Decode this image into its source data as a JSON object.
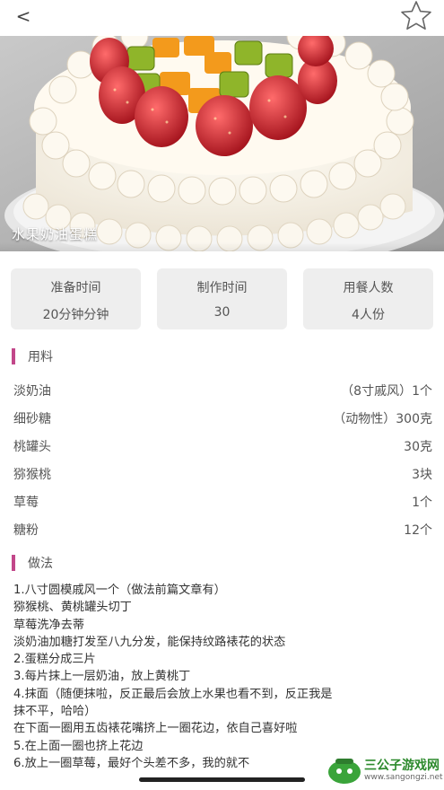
{
  "nav": {
    "back_glyph": "<",
    "back_icon": "chevron-left-icon",
    "favorite_icon": "star-outline-icon"
  },
  "hero": {
    "title": "水果奶油蛋糕"
  },
  "info_cards": [
    {
      "label": "准备时间",
      "value": "20分钟分钟"
    },
    {
      "label": "制作时间",
      "value": "30"
    },
    {
      "label": "用餐人数",
      "value": "4人份"
    }
  ],
  "ingredients": {
    "title": "用料",
    "items": [
      {
        "name": "淡奶油",
        "amount": "（8寸戚风）1个"
      },
      {
        "name": "细砂糖",
        "amount": "（动物性）300克"
      },
      {
        "name": "桃罐头",
        "amount": "30克"
      },
      {
        "name": "猕猴桃",
        "amount": "3块"
      },
      {
        "name": "草莓",
        "amount": "1个"
      },
      {
        "name": "糖粉",
        "amount": "12个"
      }
    ]
  },
  "method": {
    "title": "做法",
    "lines": [
      "1.八寸圆模戚风一个（做法前篇文章有）",
      "猕猴桃、黄桃罐头切丁",
      "草莓洗净去蒂",
      "淡奶油加糖打发至八九分发，能保持纹路裱花的状态",
      "2.蛋糕分成三片",
      "3.每片抹上一层奶油，放上黄桃丁",
      "4.抹面（随便抹啦，反正最后会放上水果也看不到，反正我是",
      "抹不平，哈哈）",
      "在下面一圈用五齿裱花嘴挤上一圈花边，依自己喜好啦",
      "5.在上面一圈也挤上花边",
      "6.放上一圈草莓，最好个头差不多，我的就不"
    ]
  },
  "watermark": {
    "name": "三公子游戏网",
    "url": "www.sangongzi.net"
  },
  "colors": {
    "accent": "#c2478a",
    "card_bg": "#eeeeee",
    "text": "#333333",
    "text_muted": "#555555"
  }
}
